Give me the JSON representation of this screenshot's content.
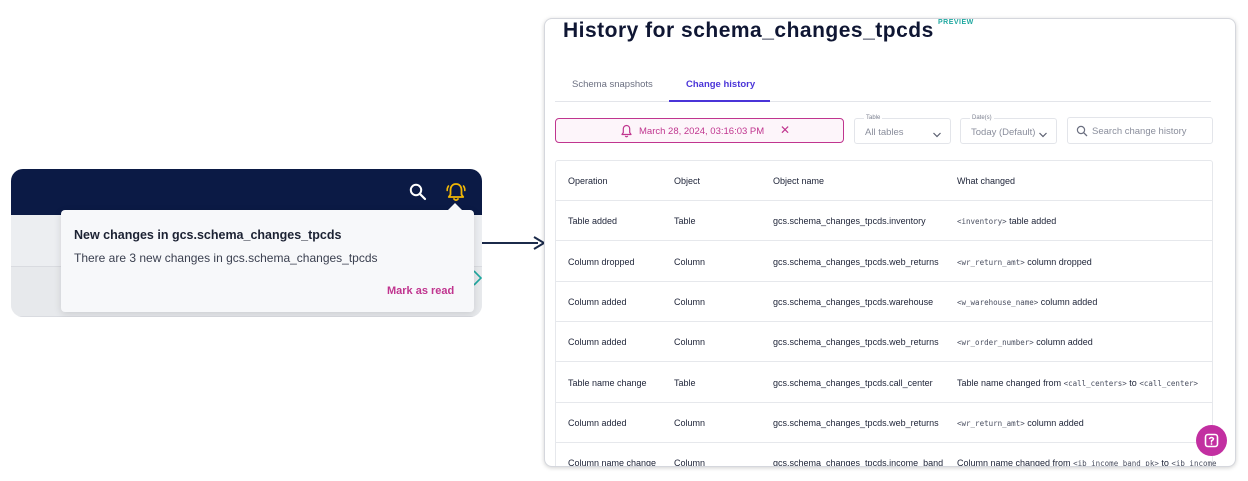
{
  "notification": {
    "title": "New changes in gcs.schema_changes_tpcds",
    "body": "There are 3 new changes in gcs.schema_changes_tpcds",
    "action": "Mark as read"
  },
  "header": {
    "icons": [
      "search-icon",
      "bell-icon"
    ]
  },
  "history": {
    "title": "History for schema_changes_tpcds",
    "badge": "PREVIEW",
    "tabs": [
      {
        "label": "Schema snapshots",
        "active": false
      },
      {
        "label": "Change history",
        "active": true
      }
    ],
    "filter_chip": "March 28, 2024, 03:16:03 PM",
    "table_filter": {
      "label": "Table",
      "value": "All tables"
    },
    "date_filter": {
      "label": "Date(s)",
      "value": "Today (Default)"
    },
    "search_placeholder": "Search change history",
    "columns": [
      "Operation",
      "Object",
      "Object name",
      "What changed"
    ],
    "rows": [
      {
        "operation": "Table added",
        "object": "Table",
        "object_name": "gcs.schema_changes_tpcds.inventory",
        "changed": [
          {
            "code": "<inventory>"
          },
          {
            "text": " table added"
          }
        ]
      },
      {
        "operation": "Column dropped",
        "object": "Column",
        "object_name": "gcs.schema_changes_tpcds.web_returns",
        "changed": [
          {
            "code": "<wr_return_amt>"
          },
          {
            "text": " column dropped"
          }
        ]
      },
      {
        "operation": "Column added",
        "object": "Column",
        "object_name": "gcs.schema_changes_tpcds.warehouse",
        "changed": [
          {
            "code": "<w_warehouse_name>"
          },
          {
            "text": " column added"
          }
        ]
      },
      {
        "operation": "Column added",
        "object": "Column",
        "object_name": "gcs.schema_changes_tpcds.web_returns",
        "changed": [
          {
            "code": "<wr_order_number>"
          },
          {
            "text": " column added"
          }
        ]
      },
      {
        "operation": "Table name change",
        "object": "Table",
        "object_name": "gcs.schema_changes_tpcds.call_center",
        "changed": [
          {
            "text": "Table name changed from "
          },
          {
            "code": "<call_centers>"
          },
          {
            "text": " to "
          },
          {
            "code": "<call_center>"
          }
        ]
      },
      {
        "operation": "Column added",
        "object": "Column",
        "object_name": "gcs.schema_changes_tpcds.web_returns",
        "changed": [
          {
            "code": "<wr_return_amt>"
          },
          {
            "text": " column added"
          }
        ]
      },
      {
        "operation": "Column name change",
        "object": "Column",
        "object_name": "gcs.schema_changes_tpcds.income_band",
        "changed": [
          {
            "text": "Column name changed from "
          },
          {
            "code": "<ib_income_band_pk>"
          },
          {
            "text": " to "
          },
          {
            "code": "<ib_income"
          }
        ]
      }
    ]
  },
  "colors": {
    "navy": "#0b1a45",
    "accent_purple": "#4a34d8",
    "magenta": "#c0358f",
    "bell_yellow": "#f2b705",
    "teal": "#1fa8a0"
  }
}
